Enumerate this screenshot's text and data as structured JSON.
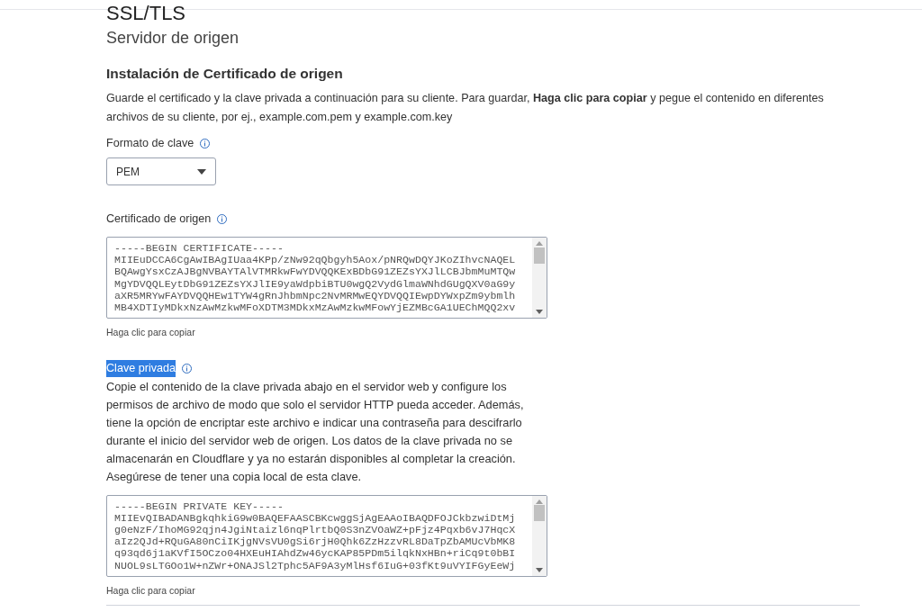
{
  "page": {
    "title": "SSL/TLS",
    "subtitle": "Servidor de origen"
  },
  "section": {
    "heading": "Instalación de Certificado de origen",
    "description": "Guarde el certificado y la clave privada a continuación para su cliente. Para guardar, **Haga clic para copiar** y pegue el contenido en diferentes archivos de su cliente, por ej., example.com.pem y example.com.key"
  },
  "key_format": {
    "label": "Formato de clave",
    "value": "PEM"
  },
  "certificate": {
    "label": "Certificado de origen",
    "lines": [
      "-----BEGIN CERTIFICATE-----",
      "MIIEuDCCA6CgAwIBAgIUaa4KPp/zNw92qQbgyh5Aox/pNRQwDQYJKoZIhvcNAQEL",
      "BQAwgYsxCzAJBgNVBAYTAlVTMRkwFwYDVQQKExBDbG91ZEZsYXJlLCBJbmMuMTQw",
      "MgYDVQQLEytDbG91ZEZsYXJlIE9yaWdpbiBTU0wgQ2VydGlmaWNhdGUgQXV0aG9y",
      "aXR5MRYwFAYDVQQHEw1TYW4gRnJhbmNpc2NvMRMwEQYDVQQIEwpDYWxpZm9ybmlh",
      "MB4XDTIyMDkxNzAwMzkwMFoXDTM3MDkxMzAwMzkwMFowYjEZMBcGA1UEChMQQ2xv"
    ],
    "copy_hint": "Haga clic para copiar"
  },
  "private_key": {
    "label": "Clave privada",
    "highlighted": true,
    "description": "Copie el contenido de la clave privada abajo en el servidor web y configure los permisos de archivo de modo que solo el servidor HTTP pueda acceder. Además, tiene la opción de encriptar este archivo e indicar una contraseña para descifrarlo durante el inicio del servidor web de origen. Los datos de la clave privada no se almacenarán en Cloudflare y ya no estarán disponibles al completar la creación. Asegúrese de tener una copia local de esta clave.",
    "lines": [
      "-----BEGIN PRIVATE KEY-----",
      "MIIEvQIBADANBgkqhkiG9w0BAQEFAASCBKcwggSjAgEAAoIBAQDFOJCkbzwiDtMj",
      "g0eNzF/IhoMG92qjn4JgiNtaizl6nqPlrtbQ0S3nZVOaWZ+pFjz4Pqxb6vJ7HqcX",
      "aIz2QJd+RQuGA80nCiIKjgNVsVU0gSi6rjH0Qhk6ZzHzzvRL8DaTpZbAMUcVbMK8",
      "q93qd6j1aKVfI5OCzo04HXEuHIAhdZw46ycKAP85PDm5ilqkNxHBn+riCq9t0bBI",
      "NUOL9sLTGOo1W+nZWr+ONAJSl2Tphc5AF9A3yMlHsf6IuG+03fKt9uVYIFGyEeWj"
    ],
    "copy_hint": "Haga clic para copiar"
  }
}
